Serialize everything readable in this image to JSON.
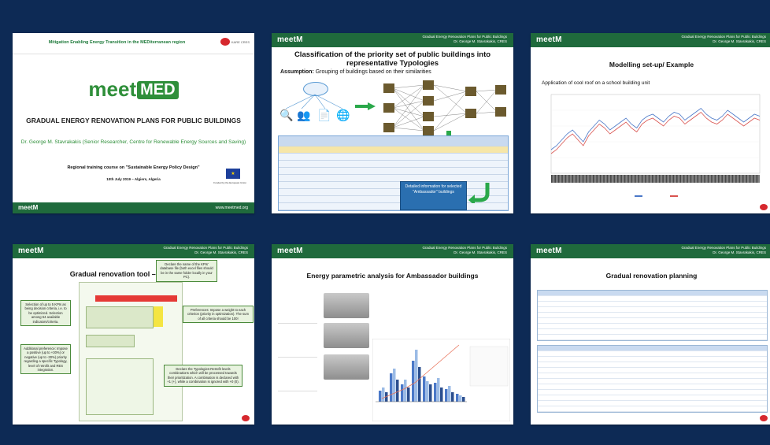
{
  "slides": {
    "s1": {
      "header": "Mitigation Enabling Energy Transition in the MEDiterranean region",
      "kares": "KARE CRES",
      "logo_a": "meet",
      "logo_b": "MED",
      "title": "GRADUAL ENERGY RENOVATION PLANS FOR PUBLIC BUILDINGS",
      "author": "Dr. George M. Stavrakakis (Senior Researcher, Centre for Renewable Energy Sources and Saving)",
      "course": "Regional training course on \"Sustainable Energy Policy Design\"",
      "date": "10th July 2019 – Algiers, Algeria",
      "eu": "Funded by the European Union",
      "bottom_logo": "meetM",
      "url": "www.meetmed.org"
    },
    "s2": {
      "logo": "meetM",
      "meta1": "Gradual Energy Renovation Plans for Public Buildings",
      "meta2": "Dr. George M. Stavrakakis, CRES",
      "title": "Classification of the priority set of public buildings into representative Typologies",
      "assumption_label": "Assumption:",
      "assumption_text": " Grouping of buildings based on their similarities",
      "popup": "Detailed information for selected \"Ambassador\" buildings"
    },
    "s3": {
      "logo": "meetM",
      "meta1": "Gradual Energy Renovation Plans for Public Buildings",
      "meta2": "Dr. George M. Stavrakakis, CRES",
      "title": "Modelling set-up/ Example",
      "subtitle": "Application of cool roof on a school building unit"
    },
    "s4": {
      "logo": "meetM",
      "meta1": "Gradual Energy Renovation Plans for Public Buildings",
      "meta2": "Dr. George M. Stavrakakis, CRES",
      "title": "Gradual renovation tool – Short guide",
      "note1": "Declare the name of the KPIs' database file (both excel files should be in the same folder locally in your PC).",
      "note2": "Selection of up to 5 KPIs as being decision criteria, i.e. to be optimized. Selection among 64 available indicators/criteria.",
      "note3": "Preferences: Impose a weight to each criterion (priority in optimization). The sum of all criteria should be 100!",
      "note4": "Additional preference: Impose a positive (up to +30%) or negative (up to -30%) priority regarding a specific Typology, level of retrofit and RES integration.",
      "note5": "Declare the Typologies-Retrofit levels combinations which will be processed towards their prioritization. A combination is declared with +1 (+), while a combination is ignored with +0 (0)."
    },
    "s5": {
      "logo": "meetM",
      "meta1": "Gradual Energy Renovation Plans for Public Buildings",
      "meta2": "Dr. George M. Stavrakakis, CRES",
      "title": "Energy parametric analysis for Ambassador buildings"
    },
    "s6": {
      "logo": "meetM",
      "meta1": "Gradual Energy Renovation Plans for Public Buildings",
      "meta2": "Dr. George M. Stavrakakis, CRES",
      "title": "Gradual renovation planning"
    }
  },
  "colors": {
    "background": "#0d2a55",
    "brand_green": "#1f6a3c",
    "accent_green": "#2f8f3a",
    "popup_blue": "#2a6fb0"
  },
  "chart_s3": {
    "type": "line",
    "series": [
      {
        "color": "#4a78c8",
        "values": [
          32,
          34,
          37,
          40,
          42,
          39,
          36,
          41,
          44,
          47,
          45,
          42,
          44,
          46,
          48,
          45,
          43,
          47,
          49,
          50,
          48,
          46,
          49,
          51,
          50,
          47,
          49,
          51,
          53,
          50,
          48,
          47,
          49,
          52,
          50,
          48,
          46,
          48,
          50,
          49
        ]
      },
      {
        "color": "#d9534f",
        "values": [
          30,
          32,
          35,
          38,
          40,
          37,
          34,
          39,
          42,
          45,
          43,
          40,
          42,
          44,
          46,
          43,
          41,
          45,
          47,
          48,
          46,
          44,
          47,
          49,
          48,
          45,
          47,
          49,
          51,
          48,
          46,
          45,
          47,
          50,
          48,
          46,
          44,
          46,
          48,
          47
        ]
      }
    ]
  },
  "chart_s5": {
    "type": "bar",
    "values": [
      7,
      18,
      11,
      26,
      16,
      12,
      8,
      5
    ],
    "values_b": [
      9,
      21,
      14,
      33,
      13,
      15,
      10,
      4
    ],
    "values_c": [
      6,
      14,
      9,
      22,
      11,
      9,
      6,
      3
    ]
  }
}
